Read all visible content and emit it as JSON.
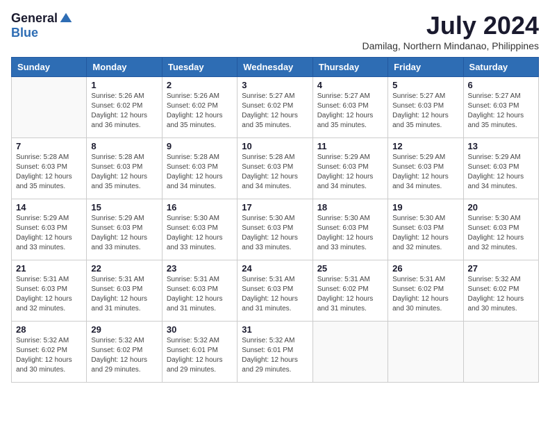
{
  "logo": {
    "general": "General",
    "blue": "Blue"
  },
  "title": "July 2024",
  "location": "Damilag, Northern Mindanao, Philippines",
  "weekdays": [
    "Sunday",
    "Monday",
    "Tuesday",
    "Wednesday",
    "Thursday",
    "Friday",
    "Saturday"
  ],
  "weeks": [
    [
      {
        "day": "",
        "info": ""
      },
      {
        "day": "1",
        "info": "Sunrise: 5:26 AM\nSunset: 6:02 PM\nDaylight: 12 hours\nand 36 minutes."
      },
      {
        "day": "2",
        "info": "Sunrise: 5:26 AM\nSunset: 6:02 PM\nDaylight: 12 hours\nand 35 minutes."
      },
      {
        "day": "3",
        "info": "Sunrise: 5:27 AM\nSunset: 6:02 PM\nDaylight: 12 hours\nand 35 minutes."
      },
      {
        "day": "4",
        "info": "Sunrise: 5:27 AM\nSunset: 6:03 PM\nDaylight: 12 hours\nand 35 minutes."
      },
      {
        "day": "5",
        "info": "Sunrise: 5:27 AM\nSunset: 6:03 PM\nDaylight: 12 hours\nand 35 minutes."
      },
      {
        "day": "6",
        "info": "Sunrise: 5:27 AM\nSunset: 6:03 PM\nDaylight: 12 hours\nand 35 minutes."
      }
    ],
    [
      {
        "day": "7",
        "info": "Sunrise: 5:28 AM\nSunset: 6:03 PM\nDaylight: 12 hours\nand 35 minutes."
      },
      {
        "day": "8",
        "info": "Sunrise: 5:28 AM\nSunset: 6:03 PM\nDaylight: 12 hours\nand 35 minutes."
      },
      {
        "day": "9",
        "info": "Sunrise: 5:28 AM\nSunset: 6:03 PM\nDaylight: 12 hours\nand 34 minutes."
      },
      {
        "day": "10",
        "info": "Sunrise: 5:28 AM\nSunset: 6:03 PM\nDaylight: 12 hours\nand 34 minutes."
      },
      {
        "day": "11",
        "info": "Sunrise: 5:29 AM\nSunset: 6:03 PM\nDaylight: 12 hours\nand 34 minutes."
      },
      {
        "day": "12",
        "info": "Sunrise: 5:29 AM\nSunset: 6:03 PM\nDaylight: 12 hours\nand 34 minutes."
      },
      {
        "day": "13",
        "info": "Sunrise: 5:29 AM\nSunset: 6:03 PM\nDaylight: 12 hours\nand 34 minutes."
      }
    ],
    [
      {
        "day": "14",
        "info": "Sunrise: 5:29 AM\nSunset: 6:03 PM\nDaylight: 12 hours\nand 33 minutes."
      },
      {
        "day": "15",
        "info": "Sunrise: 5:29 AM\nSunset: 6:03 PM\nDaylight: 12 hours\nand 33 minutes."
      },
      {
        "day": "16",
        "info": "Sunrise: 5:30 AM\nSunset: 6:03 PM\nDaylight: 12 hours\nand 33 minutes."
      },
      {
        "day": "17",
        "info": "Sunrise: 5:30 AM\nSunset: 6:03 PM\nDaylight: 12 hours\nand 33 minutes."
      },
      {
        "day": "18",
        "info": "Sunrise: 5:30 AM\nSunset: 6:03 PM\nDaylight: 12 hours\nand 33 minutes."
      },
      {
        "day": "19",
        "info": "Sunrise: 5:30 AM\nSunset: 6:03 PM\nDaylight: 12 hours\nand 32 minutes."
      },
      {
        "day": "20",
        "info": "Sunrise: 5:30 AM\nSunset: 6:03 PM\nDaylight: 12 hours\nand 32 minutes."
      }
    ],
    [
      {
        "day": "21",
        "info": "Sunrise: 5:31 AM\nSunset: 6:03 PM\nDaylight: 12 hours\nand 32 minutes."
      },
      {
        "day": "22",
        "info": "Sunrise: 5:31 AM\nSunset: 6:03 PM\nDaylight: 12 hours\nand 31 minutes."
      },
      {
        "day": "23",
        "info": "Sunrise: 5:31 AM\nSunset: 6:03 PM\nDaylight: 12 hours\nand 31 minutes."
      },
      {
        "day": "24",
        "info": "Sunrise: 5:31 AM\nSunset: 6:03 PM\nDaylight: 12 hours\nand 31 minutes."
      },
      {
        "day": "25",
        "info": "Sunrise: 5:31 AM\nSunset: 6:02 PM\nDaylight: 12 hours\nand 31 minutes."
      },
      {
        "day": "26",
        "info": "Sunrise: 5:31 AM\nSunset: 6:02 PM\nDaylight: 12 hours\nand 30 minutes."
      },
      {
        "day": "27",
        "info": "Sunrise: 5:32 AM\nSunset: 6:02 PM\nDaylight: 12 hours\nand 30 minutes."
      }
    ],
    [
      {
        "day": "28",
        "info": "Sunrise: 5:32 AM\nSunset: 6:02 PM\nDaylight: 12 hours\nand 30 minutes."
      },
      {
        "day": "29",
        "info": "Sunrise: 5:32 AM\nSunset: 6:02 PM\nDaylight: 12 hours\nand 29 minutes."
      },
      {
        "day": "30",
        "info": "Sunrise: 5:32 AM\nSunset: 6:01 PM\nDaylight: 12 hours\nand 29 minutes."
      },
      {
        "day": "31",
        "info": "Sunrise: 5:32 AM\nSunset: 6:01 PM\nDaylight: 12 hours\nand 29 minutes."
      },
      {
        "day": "",
        "info": ""
      },
      {
        "day": "",
        "info": ""
      },
      {
        "day": "",
        "info": ""
      }
    ]
  ]
}
